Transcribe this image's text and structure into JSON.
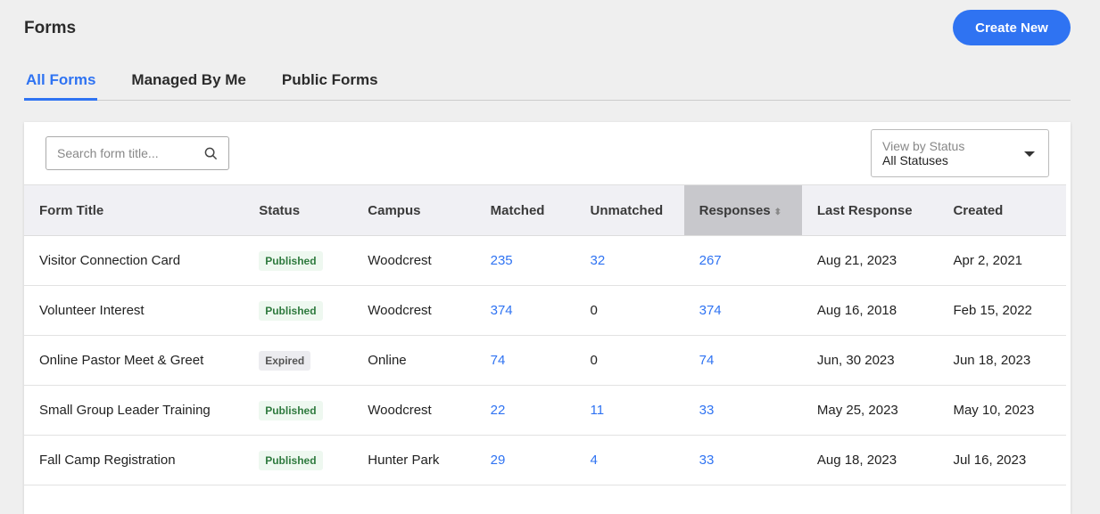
{
  "header": {
    "title": "Forms",
    "create_label": "Create New"
  },
  "tabs": [
    {
      "label": "All Forms",
      "active": true
    },
    {
      "label": "Managed By Me"
    },
    {
      "label": "Public Forms"
    }
  ],
  "search": {
    "placeholder": "Search form title..."
  },
  "status_filter": {
    "label": "View by Status",
    "value": "All Statuses"
  },
  "columns": [
    "Form Title",
    "Status",
    "Campus",
    "Matched",
    "Unmatched",
    "Responses",
    "Last Response",
    "Created"
  ],
  "sorted_column": "Responses",
  "rows": [
    {
      "title": "Visitor Connection Card",
      "status": "Published",
      "campus": "Woodcrest",
      "matched": "235",
      "unmatched": "32",
      "responses": "267",
      "last": "Aug 21, 2023",
      "created": "Apr 2, 2021"
    },
    {
      "title": "Volunteer Interest",
      "status": "Published",
      "campus": "Woodcrest",
      "matched": "374",
      "unmatched": "0",
      "responses": "374",
      "last": "Aug 16, 2018",
      "created": "Feb 15, 2022"
    },
    {
      "title": "Online Pastor Meet & Greet",
      "status": "Expired",
      "campus": "Online",
      "matched": "74",
      "unmatched": "0",
      "responses": "74",
      "last": "Jun, 30 2023",
      "created": "Jun 18, 2023"
    },
    {
      "title": "Small Group Leader Training",
      "status": "Published",
      "campus": "Woodcrest",
      "matched": "22",
      "unmatched": "11",
      "responses": "33",
      "last": "May 25, 2023",
      "created": "May 10, 2023"
    },
    {
      "title": "Fall Camp Registration",
      "status": "Published",
      "campus": "Hunter Park",
      "matched": "29",
      "unmatched": "4",
      "responses": "33",
      "last": "Aug 18, 2023",
      "created": "Jul 16, 2023"
    }
  ]
}
